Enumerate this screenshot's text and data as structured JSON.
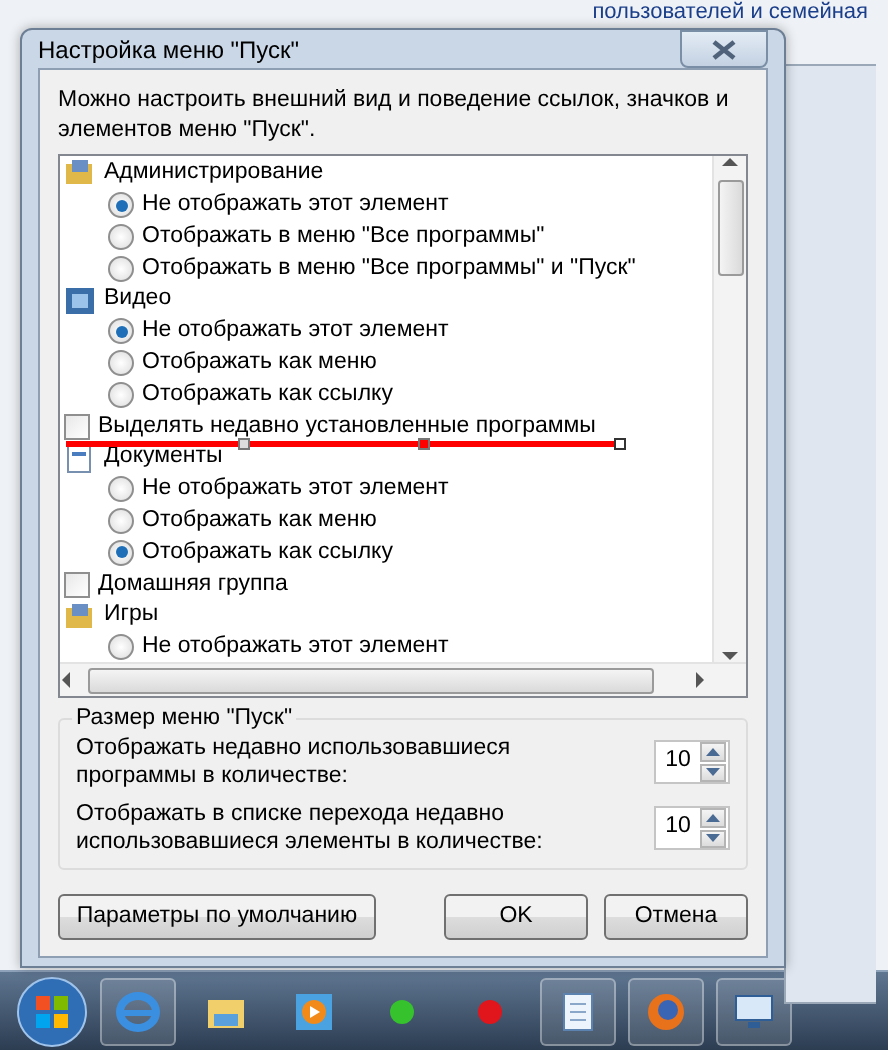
{
  "background_text": "пользователей и семейная",
  "dialog": {
    "title": "Настройка меню \"Пуск\"",
    "description": "Можно настроить внешний вид и поведение ссылок, значков и элементов меню \"Пуск\".",
    "items": [
      {
        "kind": "header",
        "label": "Администрирование",
        "children": [
          {
            "kind": "radio",
            "label": "Не отображать этот элемент",
            "selected": true
          },
          {
            "kind": "radio",
            "label": "Отображать в меню \"Все программы\"",
            "selected": false
          },
          {
            "kind": "radio",
            "label": "Отображать в меню \"Все программы\" и \"Пуск\"",
            "selected": false
          }
        ]
      },
      {
        "kind": "header",
        "label": "Видео",
        "children": [
          {
            "kind": "radio",
            "label": "Не отображать этот элемент",
            "selected": true
          },
          {
            "kind": "radio",
            "label": "Отображать как меню",
            "selected": false
          },
          {
            "kind": "radio",
            "label": "Отображать как ссылку",
            "selected": false
          }
        ]
      },
      {
        "kind": "checkbox",
        "label": "Выделять недавно установленные программы",
        "checked": false
      },
      {
        "kind": "header",
        "label": "Документы",
        "children": [
          {
            "kind": "radio",
            "label": "Не отображать этот элемент",
            "selected": false
          },
          {
            "kind": "radio",
            "label": "Отображать как меню",
            "selected": false
          },
          {
            "kind": "radio",
            "label": "Отображать как ссылку",
            "selected": true
          }
        ]
      },
      {
        "kind": "checkbox",
        "label": "Домашняя группа",
        "checked": false
      },
      {
        "kind": "header",
        "label": "Игры",
        "children": [
          {
            "kind": "radio",
            "label": "Не отображать этот элемент",
            "selected": false
          }
        ]
      }
    ],
    "size_group": {
      "title": "Размер меню \"Пуск\"",
      "spinners": [
        {
          "label": "Отображать недавно использовавшиеся программы в количестве:",
          "value": "10"
        },
        {
          "label": "Отображать в списке перехода недавно использовавшиеся элементы в количестве:",
          "value": "10"
        }
      ]
    },
    "buttons": [
      {
        "label": "Параметры по умолчанию",
        "kind": "wide"
      },
      {
        "label": "OK",
        "kind": "normal"
      },
      {
        "label": "Отмена",
        "kind": "normal"
      }
    ]
  }
}
